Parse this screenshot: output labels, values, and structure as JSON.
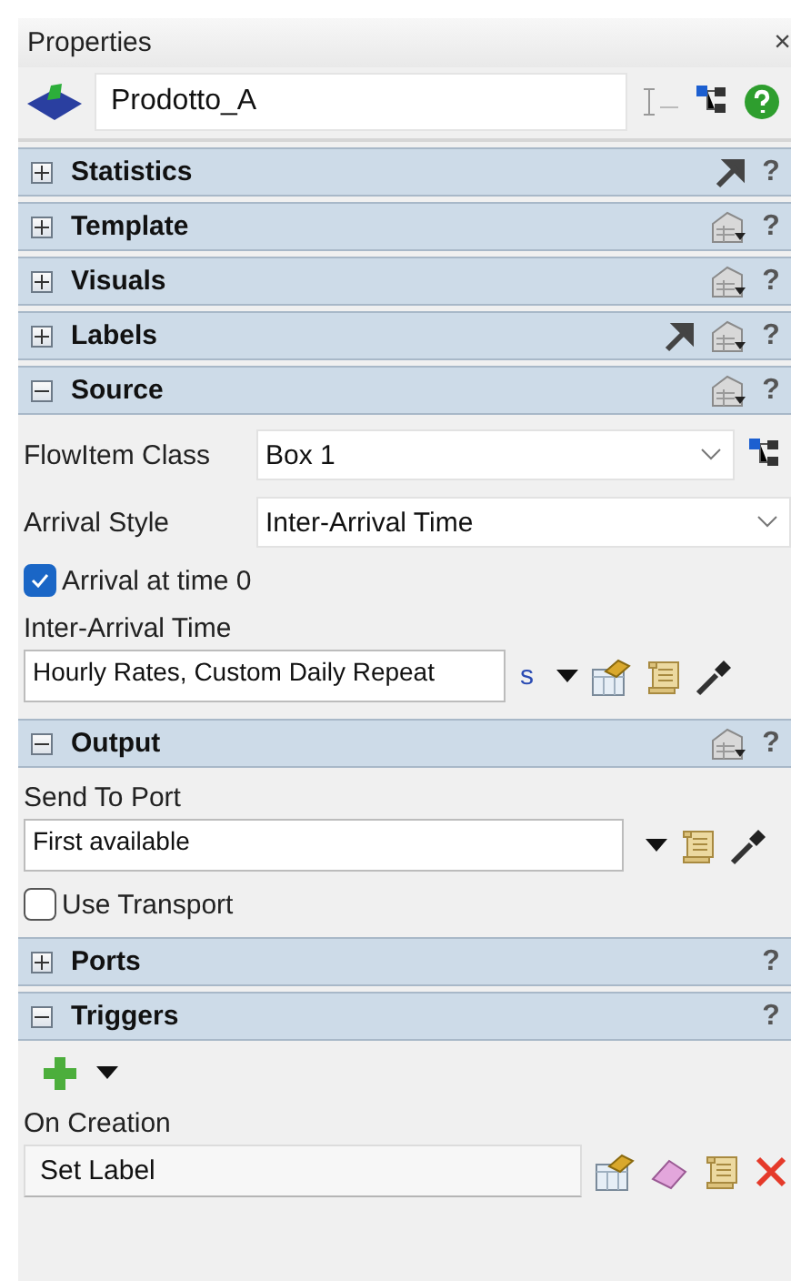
{
  "panel": {
    "title": "Properties",
    "close": "×"
  },
  "object": {
    "name": "Prodotto_A"
  },
  "sections": [
    {
      "title": "Statistics",
      "expanded": false,
      "tools": [
        {
          "kind": "arrow"
        }
      ],
      "help": "?"
    },
    {
      "title": "Template",
      "expanded": false,
      "tools": [
        {
          "kind": "options"
        }
      ],
      "help": "?"
    },
    {
      "title": "Visuals",
      "expanded": false,
      "tools": [
        {
          "kind": "options"
        }
      ],
      "help": "?"
    },
    {
      "title": "Labels",
      "expanded": false,
      "tools": [
        {
          "kind": "arrow"
        },
        {
          "kind": "options"
        }
      ],
      "help": "?"
    },
    {
      "title": "Source",
      "expanded": true,
      "tools": [
        {
          "kind": "options"
        }
      ],
      "help": "?",
      "rows": [
        {
          "kind": "combo",
          "label": "FlowItem Class",
          "value": "Box 1",
          "tree": true
        },
        {
          "kind": "combo",
          "label": "Arrival Style",
          "value": "Inter-Arrival Time",
          "tree": false
        },
        {
          "kind": "checkbox",
          "label": "Arrival at time 0",
          "checked": true
        },
        {
          "kind": "code",
          "label": "Inter-Arrival Time",
          "value": "Hourly Rates, Custom Daily Repeat",
          "unit": "s",
          "tools": [
            {
              "kind": "menu"
            },
            {
              "kind": "template"
            },
            {
              "kind": "script"
            },
            {
              "kind": "picker"
            }
          ]
        }
      ]
    },
    {
      "title": "Output",
      "expanded": true,
      "tools": [
        {
          "kind": "options"
        }
      ],
      "help": "?",
      "rows": [
        {
          "kind": "code",
          "label": "Send To Port",
          "value": "First available",
          "tools": [
            {
              "kind": "menu"
            },
            {
              "kind": "script"
            },
            {
              "kind": "picker"
            }
          ]
        },
        {
          "kind": "checkbox",
          "label": "Use Transport",
          "checked": false
        }
      ]
    },
    {
      "title": "Ports",
      "expanded": false,
      "help": "?"
    },
    {
      "title": "Triggers",
      "expanded": true,
      "help": "?",
      "rows": [
        {
          "kind": "add"
        },
        {
          "kind": "trigger",
          "label": "On Creation",
          "value": "Set Label",
          "tools": [
            {
              "kind": "template"
            },
            {
              "kind": "eraser"
            },
            {
              "kind": "script"
            },
            {
              "kind": "delete"
            }
          ]
        }
      ]
    }
  ]
}
